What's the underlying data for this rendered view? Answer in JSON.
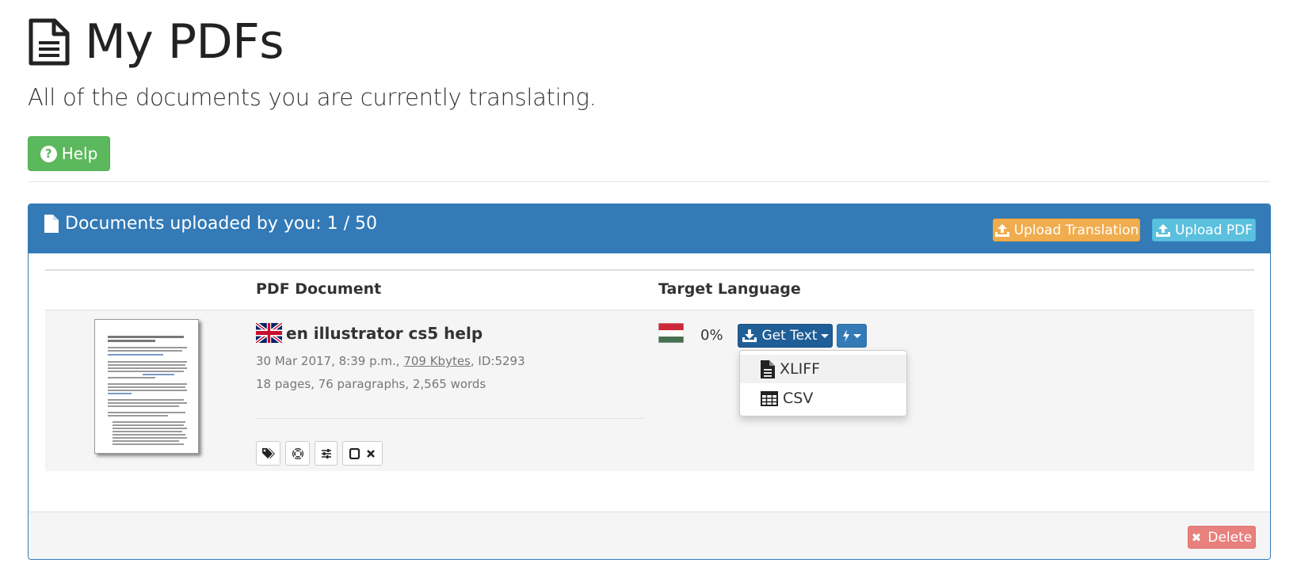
{
  "header": {
    "title": "My PDFs",
    "subtitle": "All of the documents you are currently translating.",
    "help_label": "Help",
    "title_icon": "file-text-icon"
  },
  "panel": {
    "title": "Documents uploaded by you: 1 / 50",
    "upload_translation_label": "Upload Translation",
    "upload_pdf_label": "Upload PDF",
    "colors": {
      "primary": "#337ab7",
      "success": "#5cb85c",
      "warning": "#f0ad4e",
      "info": "#5bc0de",
      "danger": "#e8807d"
    }
  },
  "table": {
    "columns": [
      "",
      "PDF Document",
      "Target Language"
    ],
    "rows": [
      {
        "source_flag": "flag-uk-icon",
        "name": "en illustrator cs5 help",
        "date": "30 Mar 2017, 8:39 p.m.,",
        "size": "709 Kbytes",
        "id": ", ID:5293",
        "stats": "18 pages, 76 paragraphs, 2,565 words",
        "target_flag": "flag-hu-icon",
        "progress": "0%",
        "get_text_label": "Get Text",
        "tools": [
          "tags-icon",
          "lifebuoy-icon",
          "sliders-icon",
          "square-x-icon"
        ]
      }
    ]
  },
  "dropdown": {
    "items": [
      {
        "label": "XLIFF",
        "icon": "file-icon"
      },
      {
        "label": "CSV",
        "icon": "table-icon"
      }
    ]
  },
  "footer": {
    "delete_label": "Delete"
  }
}
